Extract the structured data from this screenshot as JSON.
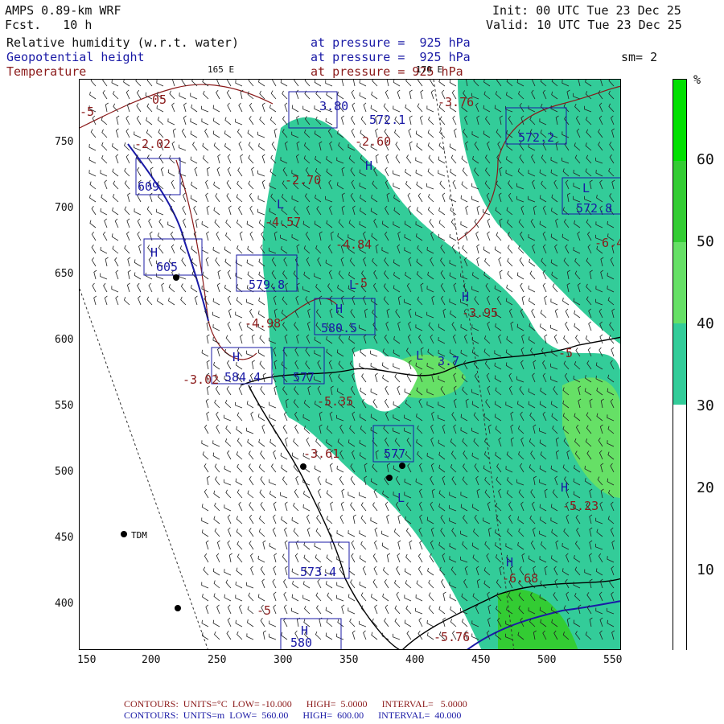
{
  "header": {
    "model": "AMPS 0.89-km WRF",
    "fcst_label": "Fcst.",
    "fcst_value": "10 h",
    "init": "Init: 00 UTC Tue 23 Dec 25",
    "valid": "Valid: 10 UTC Tue 23 Dec 25",
    "fields": [
      {
        "name": "Relative humidity (w.r.t. water)",
        "level": "at pressure =  925 hPa"
      },
      {
        "name": "Geopotential height",
        "level": "at pressure =  925 hPa"
      },
      {
        "name": "Temperature",
        "level": "at pressure = 925 hPa"
      }
    ],
    "smoothing": "sm= 2",
    "lon_labels": [
      "165 E",
      "170 E"
    ]
  },
  "colorbar": {
    "unit": "%",
    "ticks": [
      "60",
      "50",
      "40",
      "30",
      "20",
      "10"
    ],
    "colors": [
      "#00e000",
      "#33cc33",
      "#66e066",
      "#33cc99",
      "#99e6cc",
      "#ffffff"
    ]
  },
  "axes": {
    "x_ticks": [
      "150",
      "200",
      "250",
      "300",
      "350",
      "400",
      "450",
      "500",
      "550"
    ],
    "y_ticks": [
      "750",
      "700",
      "650",
      "600",
      "550",
      "500",
      "450",
      "400"
    ]
  },
  "map_labels": {
    "station": "TDM",
    "temperature_values": [
      "-3.76",
      "-2.60",
      "-2.70",
      "-4.57",
      "-4.84",
      "-3.95",
      "-4.98",
      "-3.02",
      "-5.35",
      "-3.61",
      "-5",
      "-6.4",
      "-2.02",
      "-6.68",
      "-5.23",
      "-5.76",
      "-5",
      "-5",
      "-5",
      "05"
    ],
    "height_values": [
      "572.1",
      "572.2",
      "572.8",
      "579.8",
      "580.5",
      "584.4",
      "577",
      "577",
      "573.4",
      "580",
      "609",
      "605"
    ],
    "h_labels": [
      "H",
      "H",
      "H",
      "H",
      "H",
      "H",
      "H",
      "H"
    ],
    "l_labels": [
      "L",
      "L",
      "L",
      "L",
      "L"
    ],
    "raw_values": [
      "3.80",
      "3.7"
    ]
  },
  "footer": {
    "line1": {
      "label": "CONTOURS:",
      "units": "UNITS=°C",
      "low": "LOW= -10.000",
      "high": "HIGH=  5.0000",
      "interval": "INTERVAL=   5.0000"
    },
    "line2": {
      "label": "CONTOURS:",
      "units": "UNITS=m",
      "low": "LOW=  560.00",
      "high": "HIGH=  600.00",
      "interval": "INTERVAL=  40.000"
    }
  }
}
